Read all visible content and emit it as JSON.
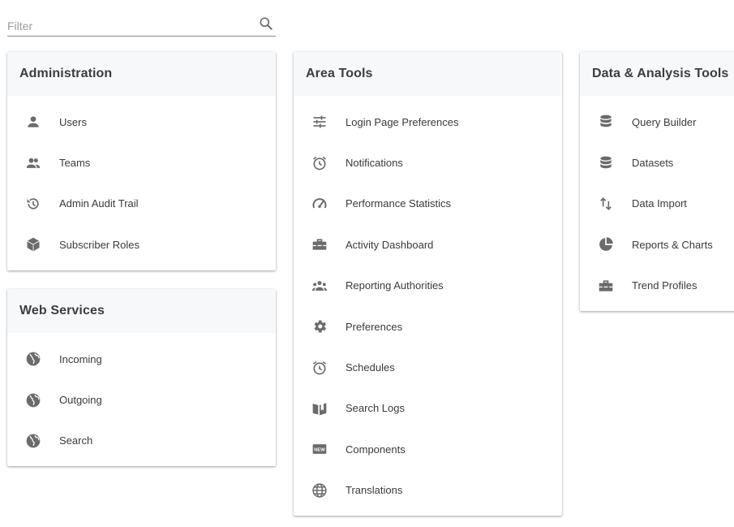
{
  "filter": {
    "placeholder": "Filter",
    "icon": "search-icon"
  },
  "colors": {
    "icon": "#6b6b6b",
    "header_bg": "#f7f8fa"
  },
  "cards": {
    "administration": {
      "title": "Administration",
      "items": [
        {
          "label": "Users",
          "icon": "person-icon"
        },
        {
          "label": "Teams",
          "icon": "people-icon"
        },
        {
          "label": "Admin Audit Trail",
          "icon": "history-icon"
        },
        {
          "label": "Subscriber Roles",
          "icon": "cube-icon"
        }
      ]
    },
    "web_services": {
      "title": "Web Services",
      "items": [
        {
          "label": "Incoming",
          "icon": "globe-icon"
        },
        {
          "label": "Outgoing",
          "icon": "globe-icon"
        },
        {
          "label": "Search",
          "icon": "globe-icon"
        }
      ]
    },
    "area_tools": {
      "title": "Area Tools",
      "items": [
        {
          "label": "Login Page Preferences",
          "icon": "sliders-icon"
        },
        {
          "label": "Notifications",
          "icon": "alarm-icon"
        },
        {
          "label": "Performance Statistics",
          "icon": "gauge-icon"
        },
        {
          "label": "Activity Dashboard",
          "icon": "toolbox-icon"
        },
        {
          "label": "Reporting Authorities",
          "icon": "group-icon"
        },
        {
          "label": "Preferences",
          "icon": "gear-icon"
        },
        {
          "label": "Schedules",
          "icon": "alarm-icon"
        },
        {
          "label": "Search Logs",
          "icon": "book-open-icon"
        },
        {
          "label": "Components",
          "icon": "new-badge-icon"
        },
        {
          "label": "Translations",
          "icon": "globe-outline-icon"
        }
      ]
    },
    "data_tools": {
      "title": "Data & Analysis Tools",
      "items": [
        {
          "label": "Query Builder",
          "icon": "database-icon"
        },
        {
          "label": "Datasets",
          "icon": "database-icon"
        },
        {
          "label": "Data Import",
          "icon": "swap-vertical-icon"
        },
        {
          "label": "Reports & Charts",
          "icon": "pie-chart-icon"
        },
        {
          "label": "Trend Profiles",
          "icon": "toolbox-icon"
        }
      ]
    }
  }
}
